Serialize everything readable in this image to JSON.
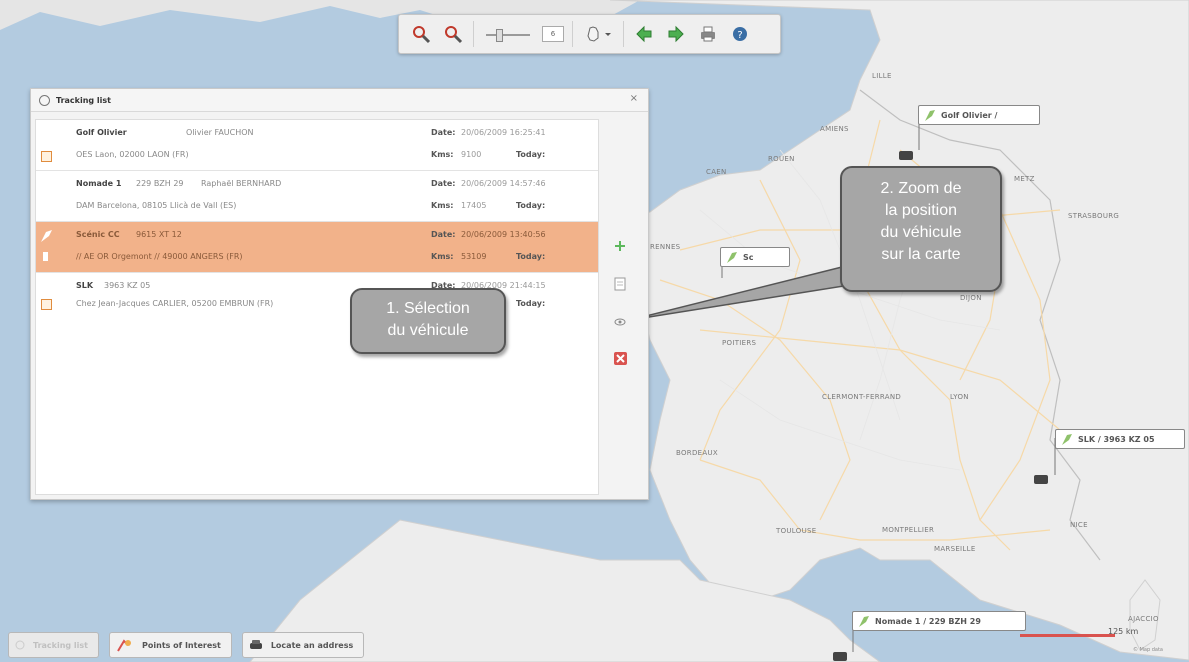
{
  "toolbar": {
    "zoom_level": "6",
    "icons": [
      "zoom-in-icon",
      "zoom-out-icon",
      "hand-icon",
      "arrow-left-icon",
      "arrow-right-icon",
      "print-icon",
      "help-icon"
    ]
  },
  "tracking": {
    "title": "Tracking list",
    "close": "×",
    "rows": [
      {
        "name": "Golf Olivier",
        "plate": "",
        "driver": "Olivier FAUCHON",
        "address": "OES Laon, 02000 LAON (FR)",
        "date_label": "Date:",
        "date": "20/06/2009 16:25:41",
        "km_label": "Kms:",
        "km": "9100",
        "today": "Today:"
      },
      {
        "name": "Nomade 1",
        "plate": "229 BZH 29",
        "driver": "Raphaël BERNHARD",
        "address": "DAM Barcelona, 08105 Llicà de Vall (ES)",
        "date_label": "Date:",
        "date": "20/06/2009 14:57:46",
        "km_label": "Kms:",
        "km": "17405",
        "today": "Today:"
      },
      {
        "name": "Scénic CC",
        "plate": "9615 XT 12",
        "driver": "",
        "address": "// AE OR Orgemont // 49000 ANGERS (FR)",
        "date_label": "Date:",
        "date": "20/06/2009 13:40:56",
        "km_label": "Kms:",
        "km": "53109",
        "today": "Today:"
      },
      {
        "name": "SLK",
        "plate": "3963 KZ 05",
        "driver": "",
        "address": "Chez Jean-Jacques CARLIER, 05200 EMBRUN (FR)",
        "date_label": "Date:",
        "date": "20/06/2009 21:44:15",
        "km_label": "",
        "km": "",
        "today": "Today:"
      }
    ]
  },
  "callouts": {
    "c1_line1": "1. Sélection",
    "c1_line2": "du véhicule",
    "c2_line1": "2. Zoom de",
    "c2_line2": "la position",
    "c2_line3": "du véhicule",
    "c2_line4": "sur la carte"
  },
  "map": {
    "cities": [
      "LILLE",
      "AMIENS",
      "ROUEN",
      "CAEN",
      "METZ",
      "STRASBOURG",
      "RENNES",
      "DIJON",
      "POITIERS",
      "CLERMONT-FERRAND",
      "LYON",
      "BORDEAUX",
      "TOULOUSE",
      "MONTPELLIER",
      "NICE",
      "MARSEILLE",
      "AJACCIO"
    ],
    "vehicle_labels": {
      "golf": "Golf Olivier /",
      "scenic": "Sc",
      "slk": "SLK / 3963 KZ 05",
      "nomade": "Nomade 1 / 229 BZH 29"
    },
    "scale": "125 km",
    "copyright": "© Map data"
  },
  "bottombar": {
    "tracking": "Tracking list",
    "poi": "Points of Interest",
    "locate": "Locate an address"
  }
}
